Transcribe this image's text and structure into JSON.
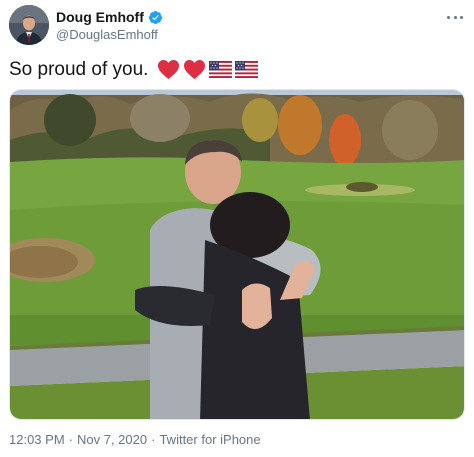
{
  "author": {
    "display_name": "Doug Emhoff",
    "handle": "@DouglasEmhoff",
    "verified": true
  },
  "tweet": {
    "text": "So proud of you.",
    "emojis": [
      "red-heart",
      "red-heart",
      "us-flag",
      "us-flag"
    ]
  },
  "meta": {
    "time": "12:03 PM",
    "separator": "·",
    "date": "Nov 7, 2020",
    "source": "Twitter for iPhone"
  },
  "colors": {
    "verified_blue": "#1da1f2",
    "text_primary": "#14171a",
    "text_secondary": "#657786",
    "heart_red": "#dd2e44"
  },
  "icons": {
    "more": "more-dots-icon",
    "verified": "verified-badge-icon"
  }
}
